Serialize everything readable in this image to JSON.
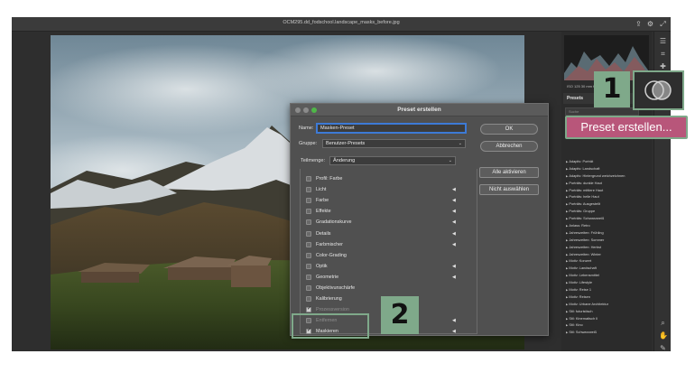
{
  "window": {
    "title": "OCM295.dd_fodschool.landscape_masks_before.jpg"
  },
  "right_panel": {
    "histogram_meta": "ISO 125   30 mm   f/11   1/60 Sek.",
    "presets_heading": "Presets",
    "search_placeholder": "Suche",
    "preset_items": [
      "Adaptiv: Porträt",
      "Adaptiv: Landschaft",
      "Adaptiv: Hintergrund weichzeichnen",
      "Porträts: dunkle Haut",
      "Porträts: mittlere Haut",
      "Porträts: helle Haut",
      "Porträts: Ausgestellt",
      "Porträts: Gruppe",
      "Porträts: Schwarzweiß",
      "Anlass: Retro",
      "Jahreszeiten: Frühling",
      "Jahreszeiten: Sommer",
      "Jahreszeiten: Herbst",
      "Jahreszeiten: Winter",
      "Motiv: Konzert",
      "Motiv: Landschaft",
      "Motiv: Lebensmittel",
      "Motiv: Lifestyle",
      "Motiv: Reise 1",
      "Motiv: Reisen",
      "Motiv: Urbane Architektur",
      "Stil: futuristisch",
      "Stil: Kinematisch II",
      "Stil: Kino",
      "Stil: Schwarzweiß"
    ]
  },
  "dialog": {
    "title": "Preset erstellen",
    "name_label": "Name:",
    "name_value": "Masken-Preset",
    "group_label": "Gruppe:",
    "group_value": "Benutzer-Presets",
    "subset_label": "Teilmenge:",
    "subset_value": "Änderung",
    "ok_label": "OK",
    "cancel_label": "Abbrechen",
    "activate_all_label": "Alle aktivieren",
    "select_none_label": "Nicht auswählen",
    "items": [
      {
        "label": "Profil: Farbe",
        "checked": false,
        "arrow": false,
        "dim": false
      },
      {
        "label": "Licht",
        "checked": false,
        "arrow": true,
        "dim": false
      },
      {
        "label": "Farbe",
        "checked": false,
        "arrow": true,
        "dim": false
      },
      {
        "label": "Effekte",
        "checked": false,
        "arrow": true,
        "dim": false
      },
      {
        "label": "Gradationskurve",
        "checked": false,
        "arrow": true,
        "dim": false
      },
      {
        "label": "Details",
        "checked": false,
        "arrow": true,
        "dim": false
      },
      {
        "label": "Farbmischer",
        "checked": false,
        "arrow": true,
        "dim": false
      },
      {
        "label": "Color-Grading",
        "checked": false,
        "arrow": false,
        "dim": false
      },
      {
        "label": "Optik",
        "checked": false,
        "arrow": true,
        "dim": false
      },
      {
        "label": "Geometrie",
        "checked": false,
        "arrow": true,
        "dim": false
      },
      {
        "label": "Objektivunschärfe",
        "checked": false,
        "arrow": false,
        "dim": false
      },
      {
        "label": "Kalibrierung",
        "checked": false,
        "arrow": false,
        "dim": false
      },
      {
        "label": "Prozessversion",
        "checked": true,
        "arrow": false,
        "dim": true
      },
      {
        "label": "Entfernen",
        "checked": false,
        "arrow": true,
        "dim": true
      },
      {
        "label": "Maskieren",
        "checked": true,
        "arrow": true,
        "dim": false
      }
    ]
  },
  "annotations": {
    "step1": "1",
    "step2": "2",
    "cta_label": "Preset erstellen..."
  }
}
